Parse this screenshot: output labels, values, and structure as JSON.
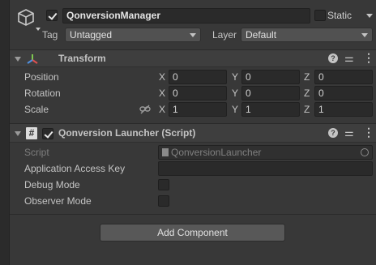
{
  "gameobject": {
    "active": true,
    "name": "QonversionManager",
    "static_label": "Static",
    "static_checked": false,
    "tag_label": "Tag",
    "tag_value": "Untagged",
    "layer_label": "Layer",
    "layer_value": "Default"
  },
  "transform": {
    "title": "Transform",
    "rows": [
      {
        "label": "Position",
        "x": "0",
        "y": "0",
        "z": "0"
      },
      {
        "label": "Rotation",
        "x": "0",
        "y": "0",
        "z": "0"
      },
      {
        "label": "Scale",
        "x": "1",
        "y": "1",
        "z": "1"
      }
    ],
    "axes": {
      "x": "X",
      "y": "Y",
      "z": "Z"
    }
  },
  "script_component": {
    "enabled": true,
    "title": "Qonversion Launcher (Script)",
    "script_label": "Script",
    "script_value": "QonversionLauncher",
    "fields": {
      "app_key_label": "Application Access Key",
      "app_key_value": "",
      "debug_label": "Debug Mode",
      "debug_checked": false,
      "observer_label": "Observer Mode",
      "observer_checked": false
    }
  },
  "add_component_label": "Add Component",
  "icons": [
    "gameobject-cube-icon",
    "transform-axes-icon",
    "script-hash-icon",
    "help-icon",
    "presets-icon",
    "kebab-menu-icon",
    "constrain-link-icon",
    "script-file-icon",
    "object-picker-icon"
  ],
  "colors": {
    "background": "#383838",
    "header": "#3e3e3e",
    "field": "#2a2a2a"
  }
}
